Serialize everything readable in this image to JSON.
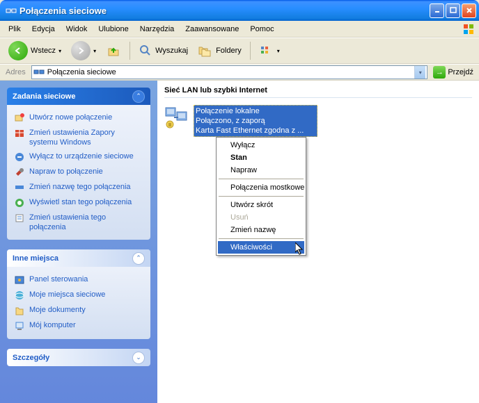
{
  "window": {
    "title": "Połączenia sieciowe"
  },
  "menu": {
    "file": "Plik",
    "edit": "Edycja",
    "view": "Widok",
    "favorites": "Ulubione",
    "tools": "Narzędzia",
    "advanced": "Zaawansowane",
    "help": "Pomoc"
  },
  "toolbar": {
    "back": "Wstecz",
    "search": "Wyszukaj",
    "folders": "Foldery"
  },
  "address": {
    "label": "Adres",
    "value": "Połączenia sieciowe",
    "go": "Przejdź"
  },
  "sidebar": {
    "tasks_title": "Zadania sieciowe",
    "tasks": [
      "Utwórz nowe połączenie",
      "Zmień ustawienia Zapory systemu Windows",
      "Wyłącz to urządzenie sieciowe",
      "Napraw to połączenie",
      "Zmień nazwę tego połączenia",
      "Wyświetl stan tego połączenia",
      "Zmień ustawienia tego połączenia"
    ],
    "places_title": "Inne miejsca",
    "places": [
      "Panel sterowania",
      "Moje miejsca sieciowe",
      "Moje dokumenty",
      "Mój komputer"
    ],
    "details_title": "Szczegóły"
  },
  "content": {
    "section": "Sieć LAN lub szybki Internet",
    "connection": {
      "name": "Połączenie lokalne",
      "status": "Połączono, z zaporą",
      "device": "Karta Fast Ethernet zgodna z ..."
    }
  },
  "context_menu": {
    "disable": "Wyłącz",
    "status": "Stan",
    "repair": "Napraw",
    "bridge": "Połączenia mostkowe",
    "shortcut": "Utwórz skrót",
    "delete": "Usuń",
    "rename": "Zmień nazwę",
    "properties": "Właściwości"
  }
}
